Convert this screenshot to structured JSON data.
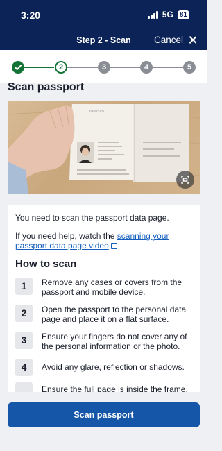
{
  "status_bar": {
    "time": "3:20",
    "network": "5G",
    "battery": "81"
  },
  "header": {
    "title": "Step 2 - Scan",
    "cancel_label": "Cancel"
  },
  "stepper": {
    "steps": [
      {
        "label": "",
        "state": "done"
      },
      {
        "label": "2",
        "state": "current"
      },
      {
        "label": "3",
        "state": "todo"
      },
      {
        "label": "4",
        "state": "todo"
      },
      {
        "label": "5",
        "state": "todo"
      }
    ]
  },
  "page_title": "Scan passport",
  "content": {
    "intro": "You need to scan the passport data page.",
    "help_prefix": "If you need help, watch the ",
    "help_link": "scanning your passport data page video",
    "how_title": "How to scan",
    "steps": [
      {
        "number": "1",
        "text": "Remove any cases or covers from the passport and mobile device."
      },
      {
        "number": "2",
        "text": "Open the passport to the personal data page and place it on a flat surface."
      },
      {
        "number": "3",
        "text": "Ensure your fingers do not cover any of the personal information or the photo."
      },
      {
        "number": "4",
        "text": "Avoid any glare, reflection or shadows."
      },
      {
        "number": "",
        "text": "Ensure the full page is inside the frame."
      }
    ]
  },
  "cta": {
    "label": "Scan passport"
  },
  "colors": {
    "header": "#0c2358",
    "accent_green": "#137337",
    "button": "#1556a8",
    "link": "#1560bd"
  }
}
